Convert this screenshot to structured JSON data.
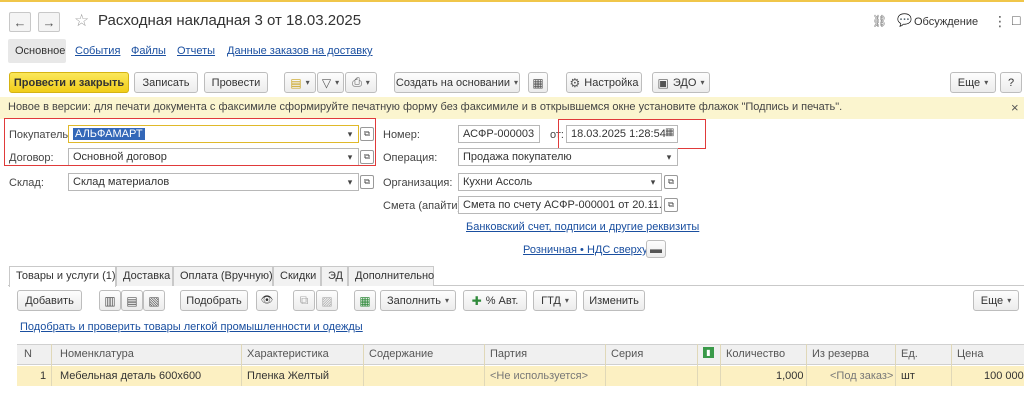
{
  "window": {
    "title": "Расходная накладная 3 от 18.03.2025",
    "discussion": "Обсуждение",
    "back": "←",
    "forward": "→",
    "star": "☆",
    "link_icon": "⛓",
    "chat_icon": "💬",
    "more_icon": "⋮",
    "maximize_icon": "□"
  },
  "doc_tabs": [
    "Основное",
    "События",
    "Файлы",
    "Отчеты",
    "Данные заказов на доставку"
  ],
  "toolbar": {
    "post_close": "Провести и закрыть",
    "save": "Записать",
    "post": "Провести",
    "create_based": "Создать на основании",
    "settings": "Настройка",
    "edo": "ЭДО",
    "more": "Еще",
    "help": "?",
    "dd": "▾"
  },
  "info": {
    "text": "Новое в версии: для печати документа с факсимиле сформируйте печатную форму без факсимиле и в открывшемся окне установите флажок \"Подпись и печать\".",
    "close": "×"
  },
  "form": {
    "buyer_label": "Покупатель:",
    "buyer_value": "АЛЬФАМАРТ",
    "contract_label": "Договор:",
    "contract_value": "Основной договор",
    "warehouse_label": "Склад:",
    "warehouse_value": "Склад материалов",
    "number_label": "Номер:",
    "number_value": "АСФР-000003",
    "from_label": "от:",
    "date_value": "18.03.2025  1:28:54",
    "operation_label": "Операция:",
    "operation_value": "Продажа покупателю",
    "org_label": "Организация:",
    "org_value": "Кухни Ассоль",
    "estimate_label": "Смета (апайти):",
    "estimate_value": "Смета по счету АСФР-000001 от 20.11.2",
    "bank_link": "Банковский счет, подписи и другие реквизиты",
    "vat_link": "Розничная • НДС сверху",
    "dd": "▾",
    "open": "⧉",
    "calendar": "▦",
    "dots": "···"
  },
  "sub_tabs": [
    "Товары и услуги (1)",
    "Доставка",
    "Оплата (Вручную)",
    "Скидки",
    "ЭД",
    "Дополнительно"
  ],
  "table_toolbar": {
    "add": "Добавить",
    "pick": "Подобрать",
    "fill": "Заполнить",
    "pct": "% Авт.",
    "gtd": "ГТД",
    "change": "Изменить",
    "more": "Еще",
    "eye": "👁",
    "dd": "▾"
  },
  "pick_link": "Подобрать и проверить товары легкой промышленности и одежды",
  "table": {
    "headers": [
      "N",
      "Номенклатура",
      "Характеристика",
      "Содержание",
      "Партия",
      "Серия",
      "Количество",
      "Из резерва",
      "Ед.",
      "Цена"
    ],
    "rows": [
      [
        "1",
        "Мебельная деталь 600х600",
        "Пленка Желтый",
        "",
        "<Не используется>",
        "",
        "1,000",
        "<Под заказ>",
        "шт",
        "100 000"
      ]
    ]
  },
  "colors": {
    "accent": "#f1cd19",
    "link": "#1a4fa0",
    "highlight": "#e03a3a",
    "row_selected": "#fcf0c2",
    "info_bg": "#fbf5cf"
  }
}
